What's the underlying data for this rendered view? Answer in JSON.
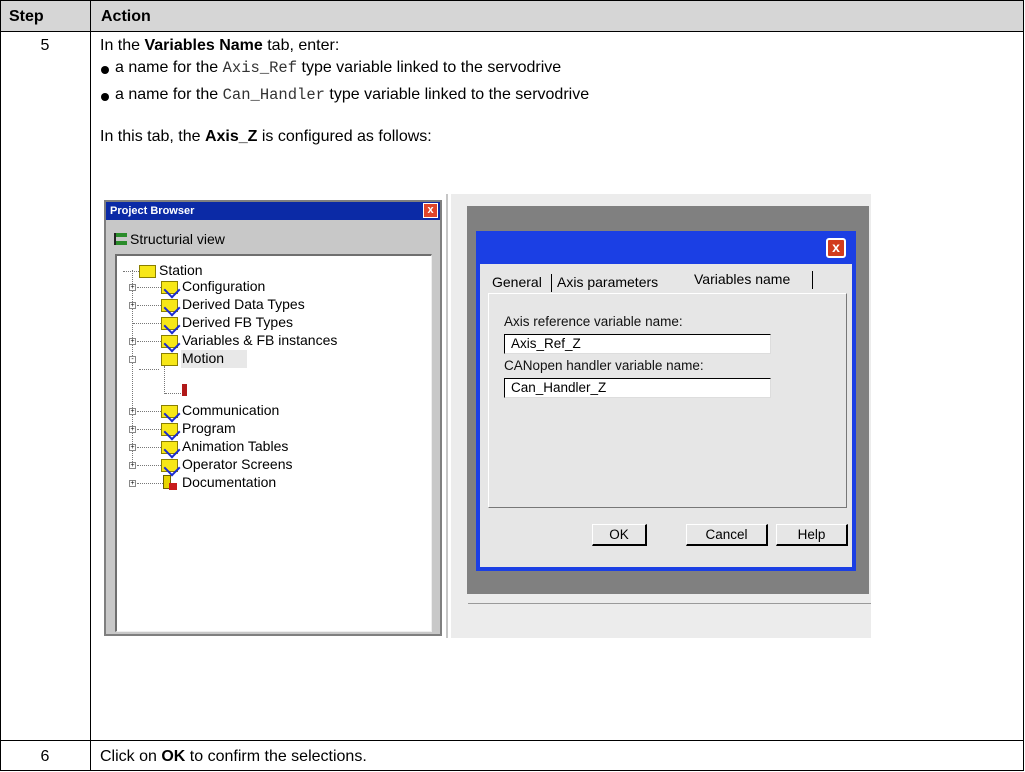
{
  "table": {
    "header": {
      "step": "Step",
      "action": "Action"
    },
    "rows": [
      {
        "step": "5",
        "intro_prefix": "In the ",
        "intro_bold": "Variables Name",
        "intro_suffix": "  tab, enter:",
        "bullets": [
          {
            "prefix": "a name for the ",
            "code": "Axis_Ref",
            "suffix": " type variable linked to the servodrive"
          },
          {
            "prefix": "a name for the ",
            "code": "Can_Handler",
            "suffix": " type variable linked to the servodrive"
          }
        ],
        "config_prefix": "In this tab, the ",
        "config_bold": "Axis_Z",
        "config_suffix": " is configured as follows:"
      },
      {
        "step": "6",
        "prefix": "Click on ",
        "bold": "OK",
        "suffix": " to confirm the selections."
      }
    ]
  },
  "project_browser": {
    "title": "Project Browser",
    "close": "x",
    "view_label": "Structurial view",
    "tree": [
      {
        "label": "Station"
      },
      {
        "label": "Configuration"
      },
      {
        "label": "Derived Data Types"
      },
      {
        "label": "Derived FB Types"
      },
      {
        "label": "Variables & FB instances"
      },
      {
        "label": "Motion"
      },
      {
        "label": "Communication"
      },
      {
        "label": "Program"
      },
      {
        "label": "Animation Tables"
      },
      {
        "label": "Operator Screens"
      },
      {
        "label": "Documentation"
      }
    ]
  },
  "dialog": {
    "close": "x",
    "tabs": [
      "General",
      "Axis parameters",
      "Variables name"
    ],
    "active_tab": "Variables name",
    "fields": [
      {
        "label": "Axis reference variable name:",
        "value": "Axis_Ref_Z"
      },
      {
        "label": "CANopen handler variable name:",
        "value": "Can_Handler_Z"
      }
    ],
    "buttons": {
      "ok": "OK",
      "cancel": "Cancel",
      "help": "Help"
    }
  },
  "colors": {
    "header_bg": "#d6d6d6",
    "titlebar_blue": "#0b2aa6",
    "dialog_blue": "#1b3fe4",
    "close_red": "#d23b1d",
    "folder_yellow": "#f7e718"
  }
}
